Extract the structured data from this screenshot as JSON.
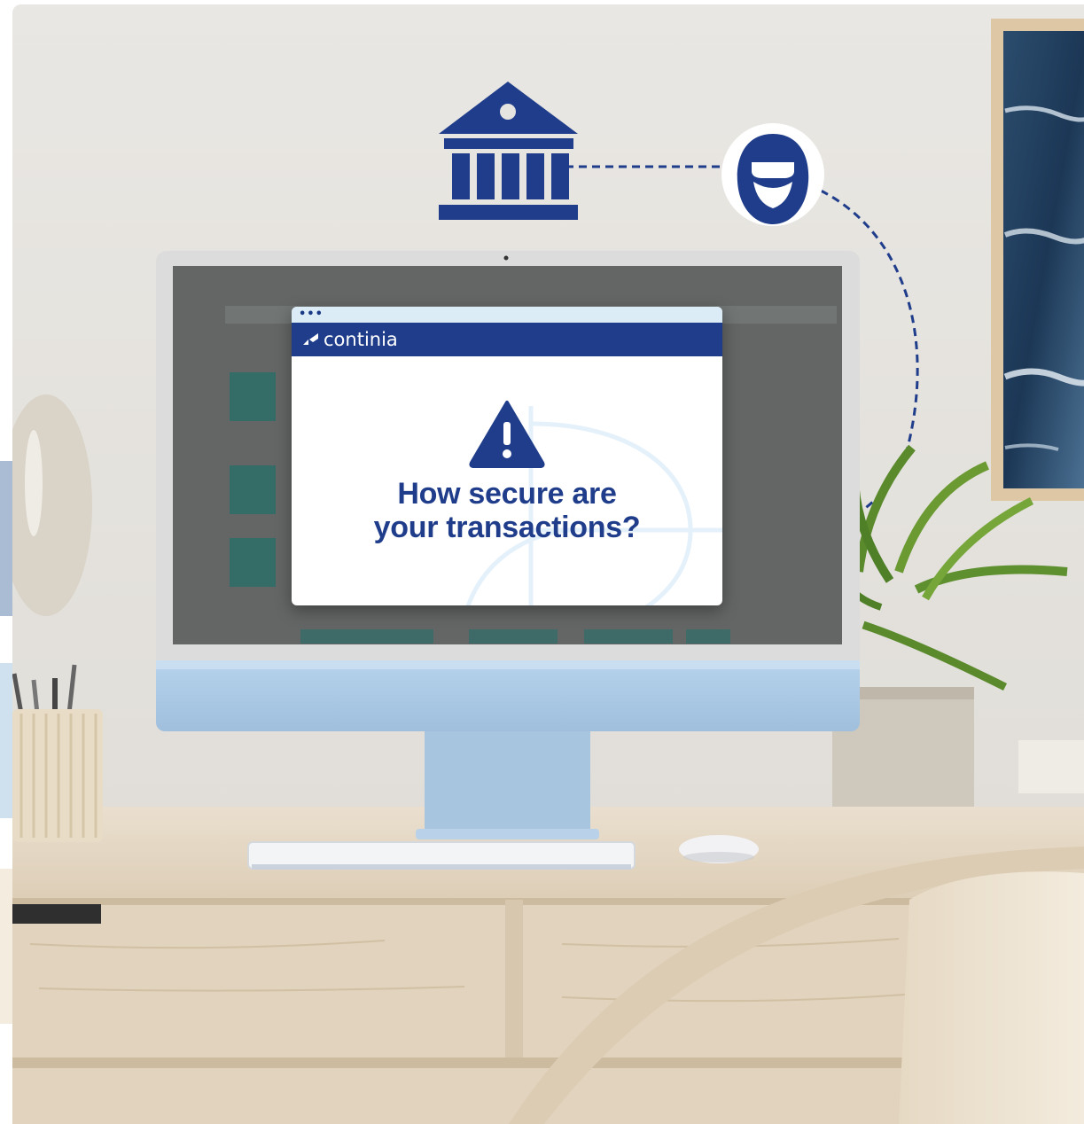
{
  "popup": {
    "brand": "continia",
    "headline_line1": "How secure are",
    "headline_line2": "your transactions?"
  },
  "icons": {
    "bank": "bank-icon",
    "hacker": "hacker-icon",
    "warning": "warning-icon",
    "brand_mark": "continia-logo-icon"
  },
  "colors": {
    "brand_navy": "#1f3d8a",
    "popup_top_bar": "#dcecf7",
    "wall": "#e6e4e0",
    "monitor_chin": "#a9c8e6",
    "desk_wood": "#e3d6c2"
  }
}
